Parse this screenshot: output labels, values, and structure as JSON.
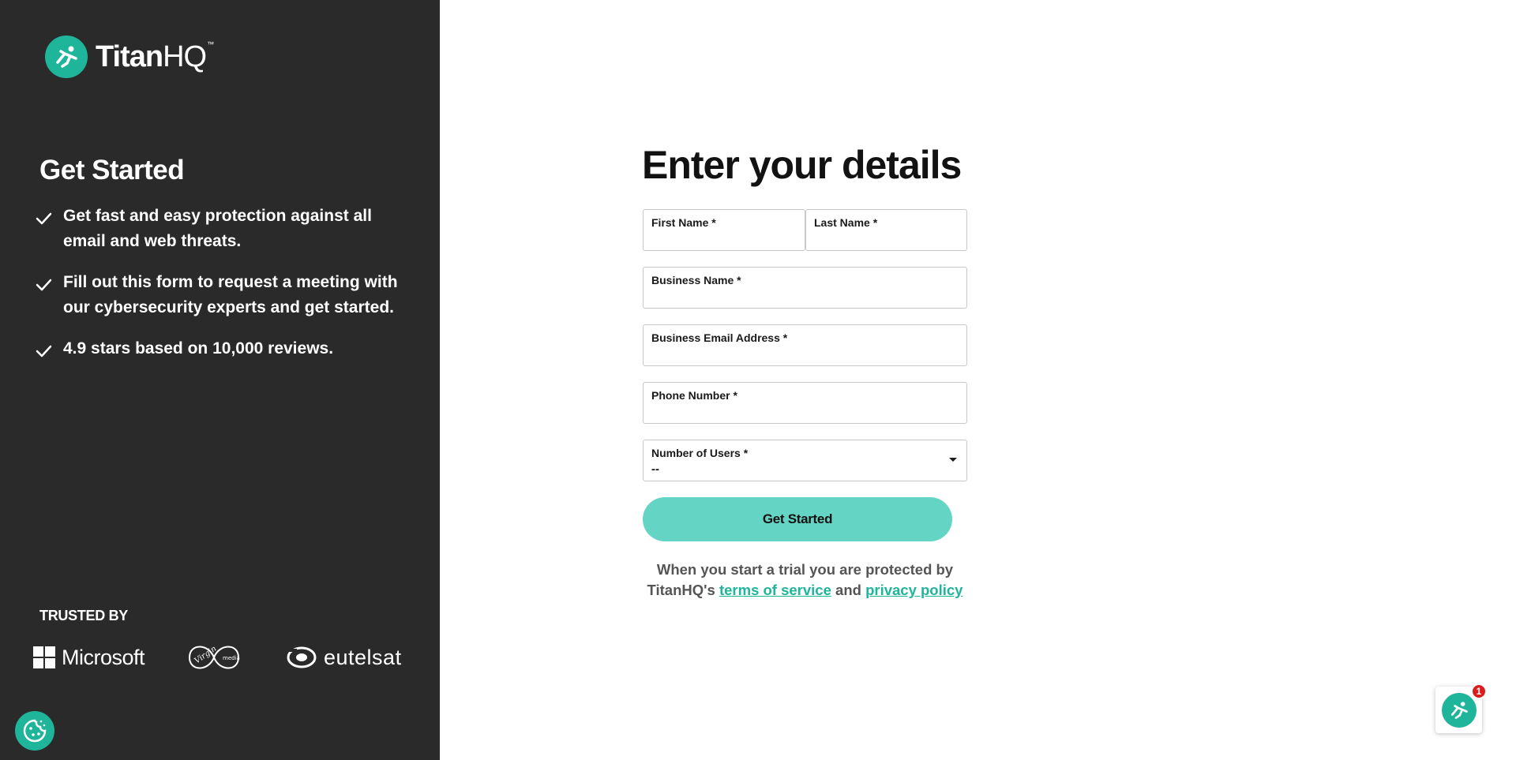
{
  "brand": {
    "logo_bold": "Titan",
    "logo_light": "HQ",
    "logo_tm": "™"
  },
  "left": {
    "heading": "Get Started",
    "bullets": [
      "Get fast and easy protection against all email and web threats.",
      "Fill out this form to request a meeting with our cybersecurity experts and get started.",
      "4.9 stars based on 10,000 reviews."
    ],
    "trusted_label": "TRUSTED BY",
    "trusted_brands": {
      "microsoft": "Microsoft",
      "virgin": "Virgin media",
      "eutelsat": "eutelsat"
    }
  },
  "form": {
    "title": "Enter your details",
    "first_name_label": "First Name *",
    "last_name_label": "Last Name *",
    "business_name_label": "Business Name *",
    "email_label": "Business Email Address *",
    "phone_label": "Phone Number *",
    "users_label": "Number of Users *",
    "users_value": "--",
    "submit_label": "Get Started"
  },
  "disclaimer": {
    "text_before": "When you start a trial you are protected by TitanHQ's ",
    "terms_link": "terms of service",
    "text_middle": " and ",
    "privacy_link": "privacy policy"
  },
  "chat": {
    "badge_count": "1"
  },
  "colors": {
    "panel_bg": "#2a2a2a",
    "accent": "#1fb59b",
    "button_bg": "#64d5c4",
    "badge": "#d81e1e"
  },
  "icons": {
    "logo": "titanhq-runner-icon",
    "bullet": "checkmark-icon",
    "cookie": "cookie-icon",
    "chat": "chat-avatar-icon",
    "dropdown": "chevron-down-icon"
  }
}
